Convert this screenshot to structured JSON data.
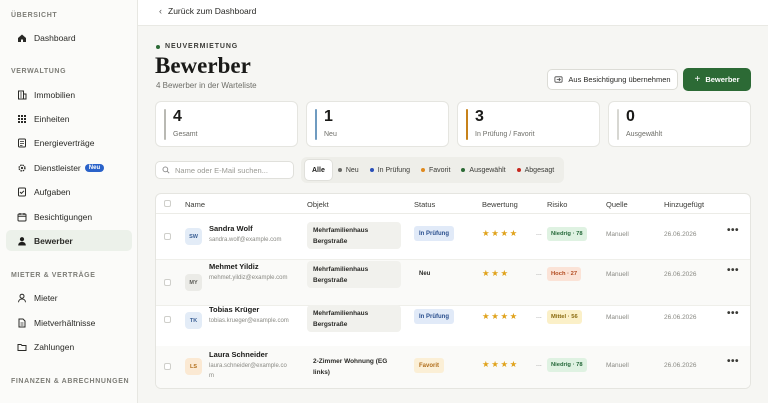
{
  "sidebar": {
    "sections": [
      {
        "label": "ÜBERSICHT"
      },
      {
        "label": "VERWALTUNG"
      },
      {
        "label": "MIETER & VERTRÄGE"
      },
      {
        "label": "FINANZEN & ABRECHNUNGEN"
      }
    ],
    "items": [
      {
        "label": "Dashboard",
        "icon": "home-icon"
      },
      {
        "label": "Immobilien",
        "icon": "building-icon"
      },
      {
        "label": "Einheiten",
        "icon": "grid-icon"
      },
      {
        "label": "Energieverträge",
        "icon": "contract-icon"
      },
      {
        "label": "Dienstleister",
        "icon": "gear-icon",
        "badge": "Neu"
      },
      {
        "label": "Aufgaben",
        "icon": "tasks-icon"
      },
      {
        "label": "Besichtigungen",
        "icon": "calendar-icon"
      },
      {
        "label": "Bewerber",
        "icon": "user-icon",
        "active": true
      },
      {
        "label": "Mieter",
        "icon": "person-icon"
      },
      {
        "label": "Mietverhältnisse",
        "icon": "document-icon"
      },
      {
        "label": "Zahlungen",
        "icon": "folder-icon"
      }
    ]
  },
  "topbar": {
    "back_label": "Zurück zum Dashboard"
  },
  "header": {
    "eyebrow": "NEUVERMIETUNG",
    "title": "Bewerber",
    "subtitle": "4 Bewerber in der Warteliste",
    "import_button": "Aus Besichtigung übernehmen",
    "add_button": "Bewerber"
  },
  "stats": [
    {
      "value": "4",
      "label": "Gesamt",
      "color": "#b9b9b3"
    },
    {
      "value": "1",
      "label": "Neu",
      "color": "#6f9bc0"
    },
    {
      "value": "3",
      "label": "In Prüfung / Favorit",
      "color": "#c7821a"
    },
    {
      "value": "0",
      "label": "Ausgewählt",
      "color": "#d7d7d2"
    }
  ],
  "search": {
    "placeholder": "Name oder E-Mail suchen..."
  },
  "filters": [
    {
      "label": "Alle",
      "active": true
    },
    {
      "label": "Neu",
      "dot": "#6a6a66"
    },
    {
      "label": "In Prüfung",
      "dot": "#2a4fb8"
    },
    {
      "label": "Favorit",
      "dot": "#e08a1e"
    },
    {
      "label": "Ausgewählt",
      "dot": "#2c6a35"
    },
    {
      "label": "Abgesagt",
      "dot": "#c7281e"
    }
  ],
  "table": {
    "headers": {
      "name": "Name",
      "objekt": "Objekt",
      "status": "Status",
      "bewertung": "Bewertung",
      "risiko": "Risiko",
      "quelle": "Quelle",
      "hinzugefuegt": "Hinzugefügt"
    },
    "rows": [
      {
        "initials": "SW",
        "name": "Sandra Wolf",
        "email": "sandra.wolf@example.com",
        "objekt": "Mehrfamilienhaus Bergstraße",
        "status": "In Prüfung",
        "stars": "★★★★",
        "ellipsis": "...",
        "risk": "Niedrig · 78",
        "source": "Manuell",
        "date": "26.06.2026"
      },
      {
        "initials": "MY",
        "name": "Mehmet Yildiz",
        "email": "mehmet.yildiz@example.com",
        "objekt": "Mehrfamilienhaus Bergstraße",
        "status": "Neu",
        "stars": "★★★",
        "ellipsis": "...",
        "risk": "Hoch · 27",
        "source": "Manuell",
        "date": "26.06.2026"
      },
      {
        "initials": "TK",
        "name": "Tobias Krüger",
        "email": "tobias.krueger@example.com",
        "objekt": "Mehrfamilienhaus Bergstraße",
        "status": "In Prüfung",
        "stars": "★★★★",
        "ellipsis": "...",
        "risk": "Mittel · 56",
        "source": "Manuell",
        "date": "26.06.2026"
      },
      {
        "initials": "LS",
        "name": "Laura Schneider",
        "email": "laura.schneider@example.com",
        "objekt": "2-Zimmer Wohnung (EG links)",
        "status": "Favorit",
        "stars": "★★★★",
        "ellipsis": "...",
        "risk": "Niedrig · 78",
        "source": "Manuell",
        "date": "26.06.2026"
      }
    ]
  }
}
